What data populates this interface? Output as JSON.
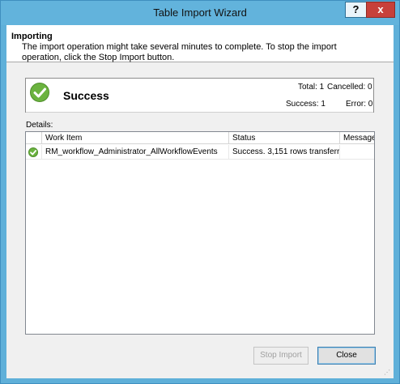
{
  "window": {
    "title": "Table Import Wizard",
    "help_label": "?",
    "close_label": "x"
  },
  "header": {
    "title": "Importing",
    "description": "The import operation might take several minutes to complete. To stop the import operation, click the Stop Import button."
  },
  "status": {
    "label": "Success",
    "icon": "check-circle-icon",
    "total": "Total: 1",
    "cancelled": "Cancelled: 0",
    "success": "Success: 1",
    "error": "Error: 0"
  },
  "details": {
    "label": "Details:",
    "columns": [
      "Work Item",
      "Status",
      "Message"
    ],
    "rows": [
      {
        "icon": "check-circle-icon",
        "work_item": "RM_workflow_Administrator_AllWorkflowEvents",
        "status": "Success. 3,151 rows transferr...",
        "message": ""
      }
    ]
  },
  "buttons": {
    "stop_import": "Stop Import",
    "close": "Close"
  },
  "colors": {
    "title_bar": "#62b3dc",
    "close_button": "#c7403a",
    "success_green": "#6bb33f"
  }
}
